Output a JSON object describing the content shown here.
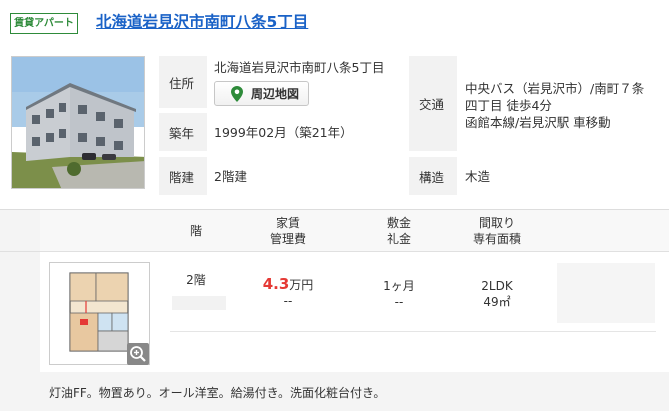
{
  "listing": {
    "type_badge": "賃貸アパート",
    "title": "北海道岩見沢市南町八条5丁目"
  },
  "details": {
    "address_label": "住所",
    "address_value": "北海道岩見沢市南町八条5丁目",
    "map_button": "周辺地図",
    "built_label": "築年",
    "built_value": "1999年02月（築21年）",
    "floors_label": "階建",
    "floors_value": "2階建",
    "transit_label": "交通",
    "transit_lines": [
      "中央バス（岩見沢市）/南町７条",
      "四丁目 徒歩4分",
      "函館本線/岩見沢駅 車移動"
    ],
    "structure_label": "構造",
    "structure_value": "木造"
  },
  "table_headers": {
    "floor": "階",
    "rent_1": "家賃",
    "rent_2": "管理費",
    "deposit_1": "敷金",
    "deposit_2": "礼金",
    "layout_1": "間取り",
    "layout_2": "専有面積"
  },
  "room": {
    "floor": "2階",
    "rent_amount": "4.3",
    "rent_unit": "万円",
    "management_fee": "--",
    "deposit": "1ヶ月",
    "key_money": "--",
    "layout": "2LDK",
    "area": "49㎡"
  },
  "footer": {
    "notes": "灯油FF。物置あり。オール洋室。給湯付き。洗面化粧台付き。"
  },
  "icons": {
    "map_pin": "map-pin-icon",
    "zoom": "zoom-icon"
  },
  "colors": {
    "title_link": "#1a62c7",
    "badge_green": "#2e8b3a",
    "rent_red": "#e53935",
    "pin_green": "#2e8b3a"
  }
}
